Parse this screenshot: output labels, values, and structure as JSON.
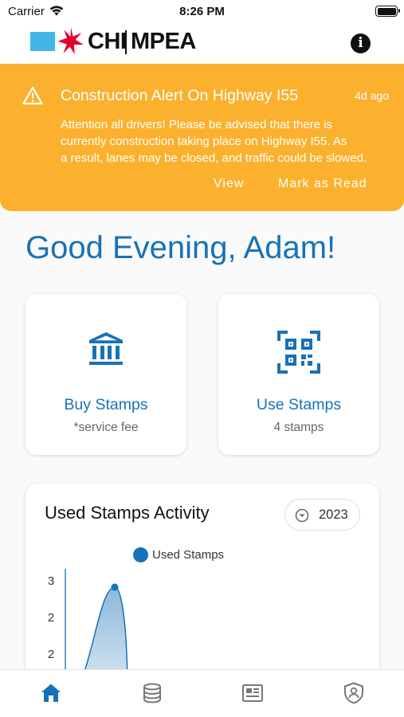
{
  "status_bar": {
    "carrier": "Carrier",
    "time": "8:26 PM"
  },
  "header": {
    "logo_left": "CHI",
    "logo_right": "MPEA",
    "info_icon": "info-icon"
  },
  "alert": {
    "title": "Construction Alert On Highway I55",
    "time_ago": "4d ago",
    "body_lines": [
      "Attention all drivers! Please be advised that there is",
      "currently construction taking place on Highway I55. As",
      "a result, lanes may be closed, and traffic could be slowed."
    ],
    "view_label": "View",
    "mark_read_label": "Mark as Read",
    "color": "#fbb12e"
  },
  "greeting": "Good Evening, Adam!",
  "cards": {
    "buy": {
      "title": "Buy Stamps",
      "subtitle": "*service fee",
      "icon": "bank-icon"
    },
    "use": {
      "title": "Use Stamps",
      "subtitle": "4 stamps",
      "icon": "qr-code-icon"
    }
  },
  "activity": {
    "title": "Used Stamps Activity",
    "year": "2023"
  },
  "chart_data": {
    "type": "area",
    "series": [
      {
        "name": "Used Stamps",
        "values": [
          0,
          3,
          0
        ]
      }
    ],
    "y_tick_labels": [
      "3",
      "2",
      "2"
    ],
    "color": "#1872b8"
  },
  "tabs": [
    {
      "icon": "home-icon",
      "active": true
    },
    {
      "icon": "database-icon",
      "active": false
    },
    {
      "icon": "news-icon",
      "active": false
    },
    {
      "icon": "shield-user-icon",
      "active": false
    }
  ],
  "colors": {
    "brand_blue": "#1872b8",
    "logo_light_blue": "#41b6e6",
    "logo_red": "#e4002b"
  }
}
